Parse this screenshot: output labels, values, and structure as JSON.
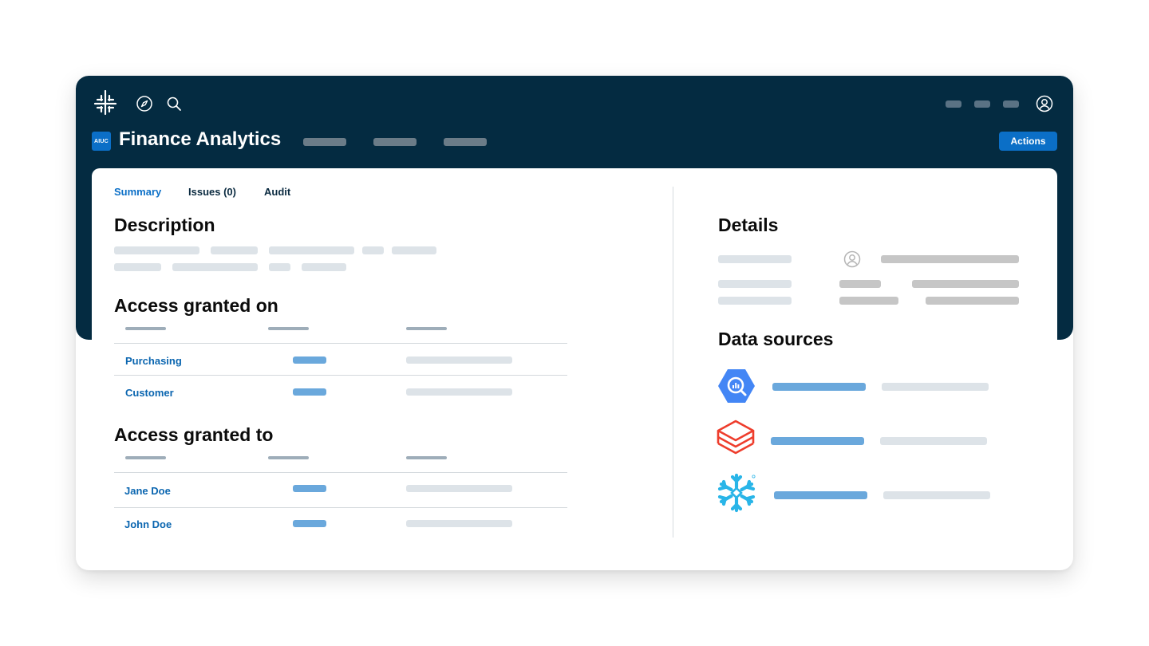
{
  "header": {
    "app_badge": "AIUC",
    "title": "Finance Analytics",
    "actions_label": "Actions"
  },
  "icons": [
    "tableau-logo-icon",
    "compass-icon",
    "search-icon",
    "user-circle-icon"
  ],
  "tabs": [
    {
      "label": "Summary",
      "active": true
    },
    {
      "label": "Issues (0)",
      "active": false
    },
    {
      "label": "Audit",
      "active": false
    }
  ],
  "sections": {
    "description": "Description",
    "access_on": "Access granted on",
    "access_to": "Access granted to",
    "details": "Details",
    "data_sources": "Data sources"
  },
  "access_granted_on": [
    "Purchasing",
    "Customer"
  ],
  "access_granted_to": [
    "Jane Doe",
    "John Doe"
  ],
  "data_sources": [
    "bigquery-icon",
    "databricks-icon",
    "snowflake-icon"
  ],
  "colors": {
    "header_bg": "#042b41",
    "accent": "#0b6fc7",
    "link": "#0b66b0"
  }
}
